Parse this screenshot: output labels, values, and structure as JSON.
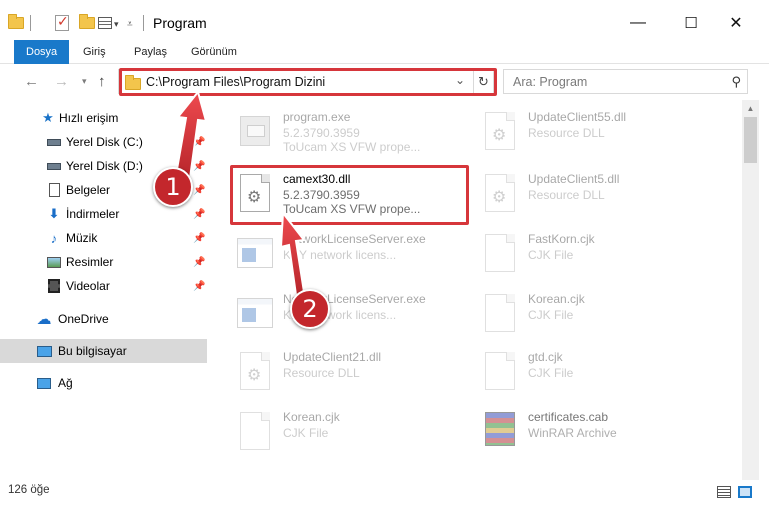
{
  "window": {
    "title": "Program",
    "controls": {
      "minimize": "—",
      "maximize": "☐",
      "close": "✕"
    }
  },
  "ribbon": {
    "tabs": [
      {
        "label": "Dosya",
        "active": true
      },
      {
        "label": "Giriş"
      },
      {
        "label": "Paylaş"
      },
      {
        "label": "Görünüm"
      }
    ]
  },
  "address": {
    "path": "C:\\Program Files\\Program Dizini",
    "search_placeholder": "Ara: Program"
  },
  "sidebar": {
    "items": [
      {
        "label": "Hızlı erişim",
        "icon": "star-icon"
      },
      {
        "label": "Yerel Disk (C:)",
        "icon": "drive-icon",
        "pinned": true
      },
      {
        "label": "Yerel Disk (D:)",
        "icon": "drive-icon",
        "pinned": true
      },
      {
        "label": "Belgeler",
        "icon": "documents-icon",
        "pinned": true
      },
      {
        "label": "İndirmeler",
        "icon": "download-icon",
        "pinned": true
      },
      {
        "label": "Müzik",
        "icon": "music-icon",
        "pinned": true
      },
      {
        "label": "Resimler",
        "icon": "pictures-icon",
        "pinned": true
      },
      {
        "label": "Videolar",
        "icon": "videos-icon",
        "pinned": true
      },
      {
        "label": "OneDrive",
        "icon": "onedrive-icon"
      },
      {
        "label": "Bu bilgisayar",
        "icon": "computer-icon",
        "selected": true
      },
      {
        "label": "Ağ",
        "icon": "network-icon"
      }
    ]
  },
  "files": {
    "left": [
      {
        "name": "program.exe",
        "line2": "5.2.3790.3959",
        "line3": "ToUcam XS VFW prope...",
        "type": "exe"
      },
      {
        "name": "camext30.dll",
        "line2": "5.2.3790.3959",
        "line3": "ToUcam XS VFW prope...",
        "type": "dll",
        "highlighted": true
      },
      {
        "name": "NetworkLicenseServer.exe",
        "line2": "KEY network licens...",
        "line3": "",
        "type": "app"
      },
      {
        "name": "NetworkLicenseServer.exe",
        "line2": "KEY network licens...",
        "line3": "",
        "type": "app"
      },
      {
        "name": "UpdateClient21.dll",
        "line2": "Resource DLL",
        "line3": "",
        "type": "dll"
      },
      {
        "name": "Korean.cjk",
        "line2": "CJK File",
        "line3": "",
        "type": "doc"
      }
    ],
    "right": [
      {
        "name": "UpdateClient55.dll",
        "line2": "Resource DLL",
        "type": "dll"
      },
      {
        "name": "UpdateClient5.dll",
        "line2": "Resource DLL",
        "type": "dll"
      },
      {
        "name": "FastKorn.cjk",
        "line2": "CJK File",
        "type": "doc"
      },
      {
        "name": "Korean.cjk",
        "line2": "CJK File",
        "type": "doc"
      },
      {
        "name": "gtd.cjk",
        "line2": "CJK File",
        "type": "doc"
      },
      {
        "name": "certificates.cab",
        "line2": "WinRAR Archive",
        "type": "rar"
      }
    ]
  },
  "status": {
    "count": "126 öğe"
  },
  "annotations": {
    "badge1": "1",
    "badge2": "2"
  },
  "colors": {
    "accent": "#1979ca",
    "highlight_red": "#d6363b",
    "badge_red": "#c3272c"
  }
}
